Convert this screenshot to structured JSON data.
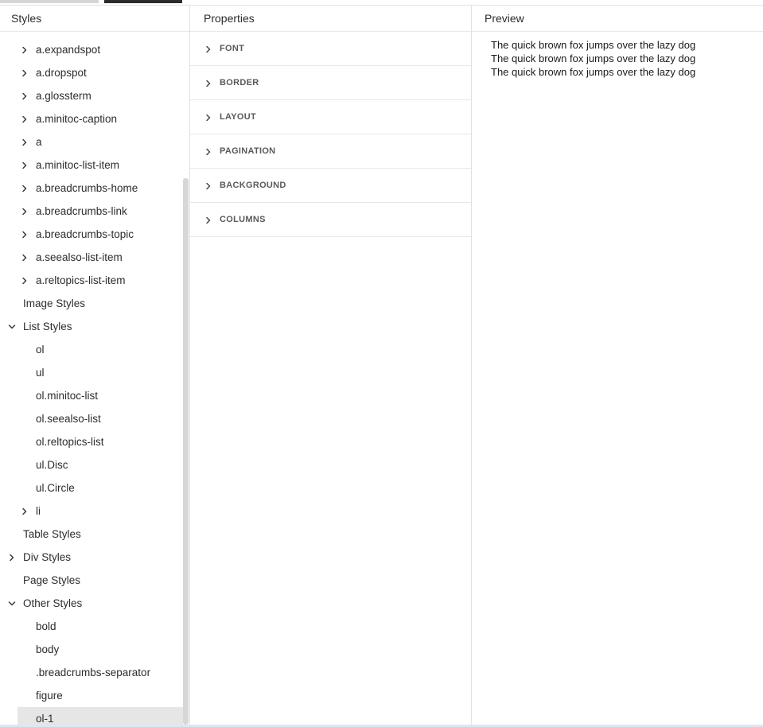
{
  "styles_panel": {
    "title": "Styles",
    "rows": [
      {
        "label": "a.expandspot",
        "chevron": "right"
      },
      {
        "label": "a.dropspot",
        "chevron": "right"
      },
      {
        "label": "a.glossterm",
        "chevron": "right"
      },
      {
        "label": "a.minitoc-caption",
        "chevron": "right"
      },
      {
        "label": "a",
        "chevron": "right"
      },
      {
        "label": "a.minitoc-list-item",
        "chevron": "right"
      },
      {
        "label": "a.breadcrumbs-home",
        "chevron": "right"
      },
      {
        "label": "a.breadcrumbs-link",
        "chevron": "right"
      },
      {
        "label": "a.breadcrumbs-topic",
        "chevron": "right"
      },
      {
        "label": "a.seealso-list-item",
        "chevron": "right"
      },
      {
        "label": "a.reltopics-list-item",
        "chevron": "right"
      },
      {
        "label": "Image Styles",
        "chevron": "none"
      },
      {
        "label": "List Styles",
        "chevron": "down"
      },
      {
        "label": "ol",
        "chevron": "none"
      },
      {
        "label": "ul",
        "chevron": "none"
      },
      {
        "label": "ol.minitoc-list",
        "chevron": "none"
      },
      {
        "label": "ol.seealso-list",
        "chevron": "none"
      },
      {
        "label": "ol.reltopics-list",
        "chevron": "none"
      },
      {
        "label": "ul.Disc",
        "chevron": "none"
      },
      {
        "label": "ul.Circle",
        "chevron": "none"
      },
      {
        "label": "li",
        "chevron": "right"
      },
      {
        "label": "Table Styles",
        "chevron": "none"
      },
      {
        "label": "Div Styles",
        "chevron": "right"
      },
      {
        "label": "Page Styles",
        "chevron": "none"
      },
      {
        "label": "Other Styles",
        "chevron": "down"
      },
      {
        "label": "bold",
        "chevron": "none"
      },
      {
        "label": "body",
        "chevron": "none"
      },
      {
        "label": ".breadcrumbs-separator",
        "chevron": "none"
      },
      {
        "label": "figure",
        "chevron": "none"
      },
      {
        "label": "ol-1",
        "chevron": "none",
        "selected": true
      }
    ]
  },
  "properties_panel": {
    "title": "Properties",
    "sections": [
      {
        "label": "FONT"
      },
      {
        "label": "BORDER"
      },
      {
        "label": "LAYOUT"
      },
      {
        "label": "PAGINATION"
      },
      {
        "label": "BACKGROUND"
      },
      {
        "label": "COLUMNS"
      }
    ]
  },
  "preview_panel": {
    "title": "Preview",
    "lines": [
      "The quick brown fox jumps over the lazy dog",
      "The quick brown fox jumps over the lazy dog",
      "The quick brown fox jumps over the lazy dog"
    ]
  },
  "colors": {
    "selected_row": "#e6e6e6",
    "scrollbar": "#d7d7d7",
    "divider": "#e1e1e1"
  }
}
